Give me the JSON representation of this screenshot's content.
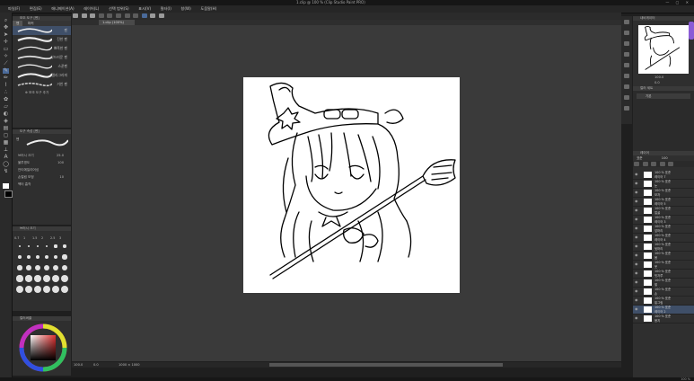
{
  "window": {
    "title": "1.clip @ 100 % (Clip Studio Paint PRO)",
    "controls": "— ▢ ✕"
  },
  "menu": [
    "파일(F)",
    "편집(E)",
    "애니메이션(A)",
    "레이어(L)",
    "선택 범위(S)",
    "표시(V)",
    "필터(I)",
    "창(W)",
    "도움말(H)"
  ],
  "document_tab": "1.clip (100%)",
  "subtool": {
    "title": "보조 도구 [펜]",
    "tabs": [
      "펜",
      "마커"
    ],
    "brushes": [
      "펜",
      "진한 펜",
      "뾰족한 펜",
      "부드러운 펜",
      "스푼펜",
      "캘리그라피",
      "거친 펜"
    ],
    "selected_index": 0,
    "add_label": "보조 도구 추가"
  },
  "tool_property": {
    "title": "도구 속성 [펜]",
    "brush_name": "펜",
    "rows": [
      {
        "label": "브러시 크기",
        "value": "25.0"
      },
      {
        "label": "불투명도",
        "value": "100"
      },
      {
        "label": "안티에일리어싱",
        "value": ""
      },
      {
        "label": "손떨림 보정",
        "value": "10"
      },
      {
        "label": "벡터 흡착",
        "value": ""
      }
    ]
  },
  "brush_size": {
    "title": "브러시 크기",
    "labels": [
      "0.7",
      "1",
      "1.5",
      "2",
      "2.5",
      "3"
    ]
  },
  "color_wheel": {
    "title": "컬러써클",
    "hue": "#e03030",
    "readout": "H 0 S 0 V 0"
  },
  "canvas_status": {
    "zoom": "100.0",
    "angle": "0.0",
    "coords": "1000 × 1000"
  },
  "navigator": {
    "title": "내비게이터",
    "zoom": "100.0",
    "angle": "0.0"
  },
  "subview": {
    "title": "서브 뷰",
    "tab": "컬러 세트",
    "dropdown": "기본"
  },
  "layers": {
    "title": "레이어",
    "blend_mode": "표준",
    "opacity": "100",
    "items": [
      {
        "opacity": "100 % 표준",
        "name": "레이어 7"
      },
      {
        "opacity": "100 % 표준",
        "name": "눈"
      },
      {
        "opacity": "100 % 표준",
        "name": "모자"
      },
      {
        "opacity": "100 % 표준",
        "name": "레이어 5"
      },
      {
        "opacity": "100 % 표준",
        "name": "얼굴"
      },
      {
        "opacity": "100 % 표준",
        "name": "레이어 3"
      },
      {
        "opacity": "100 % 표준",
        "name": "앞머리"
      },
      {
        "opacity": "100 % 표준",
        "name": "레이어 4"
      },
      {
        "opacity": "100 % 표준",
        "name": "뒷머리"
      },
      {
        "opacity": "100 % 표준",
        "name": "몸"
      },
      {
        "opacity": "100 % 표준",
        "name": "옷"
      },
      {
        "opacity": "100 % 표준",
        "name": "빗자루"
      },
      {
        "opacity": "100 % 표준",
        "name": "팔"
      },
      {
        "opacity": "100 % 표준",
        "name": "손"
      },
      {
        "opacity": "100 % 표준",
        "name": "밑그림"
      },
      {
        "opacity": "100 % 표준",
        "name": "레이어 2"
      },
      {
        "opacity": "100 % 표준",
        "name": "용지"
      }
    ],
    "selected_index": 15
  },
  "status": "100 %",
  "colors": {
    "panel": "#2f2f2f",
    "canvas_bg": "#3a3a3a",
    "selection": "#3f4f68",
    "accent": "#8a5bd6"
  }
}
